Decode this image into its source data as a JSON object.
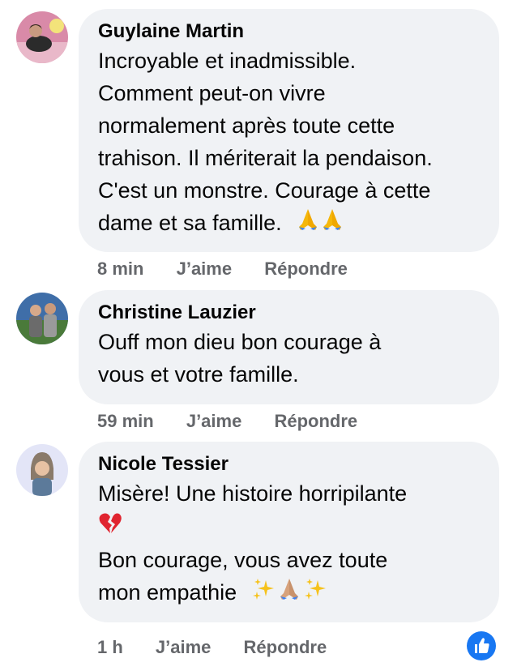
{
  "comments": [
    {
      "author": "Guylaine Martin",
      "lines": [
        "Incroyable et inadmissible.",
        "Comment peut-on vivre",
        "normalement après toute cette",
        "trahison. Il mériterait la pendaison.",
        "C'est un monstre. Courage à cette",
        "dame et sa famille."
      ],
      "emoji": [
        "folded-hands-icon",
        "folded-hands-icon"
      ],
      "time": "8 min",
      "like_label": "J’aime",
      "reply_label": "Répondre"
    },
    {
      "author": "Christine Lauzier",
      "lines": [
        "Ouff mon dieu bon courage à",
        "vous et votre famille."
      ],
      "time": "59 min",
      "like_label": "J’aime",
      "reply_label": "Répondre"
    },
    {
      "author": "Nicole Tessier",
      "lines": [
        "Misère! Une histoire horripilante",
        "",
        "Bon courage, vous avez toute",
        "mon empathie"
      ],
      "emoji": [
        "broken-heart-icon",
        "sparkles-icon",
        "folded-hands-icon",
        "sparkles-icon"
      ],
      "time": "1 h",
      "like_label": "J’aime",
      "reply_label": "Répondre",
      "reaction": "like-reaction-icon"
    }
  ],
  "colors": {
    "bubble_bg": "#f0f2f5",
    "meta_text": "#65676b",
    "like_blue": "#1877f2"
  }
}
